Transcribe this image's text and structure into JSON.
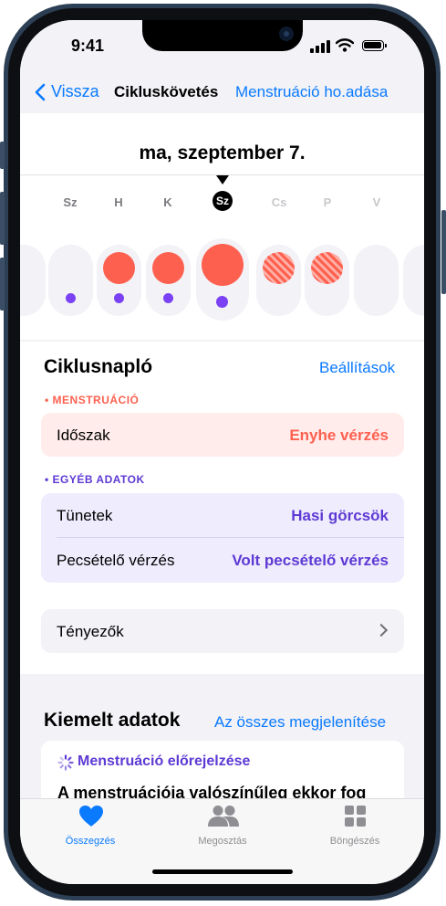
{
  "status": {
    "time": "9:41"
  },
  "nav": {
    "back": "Vissza",
    "title": "Cikluskövetés",
    "action": "Menstruáció ho.adása"
  },
  "calendar": {
    "date_title": "ma, szeptember 7.",
    "days": [
      {
        "label": ""
      },
      {
        "label": "Sz"
      },
      {
        "label": "H"
      },
      {
        "label": "K"
      },
      {
        "label": "Sz"
      },
      {
        "label": "Cs"
      },
      {
        "label": "P"
      },
      {
        "label": "V"
      },
      {
        "label": ""
      }
    ]
  },
  "log": {
    "title": "Ciklusnapló",
    "settings": "Beállítások",
    "menstruation_header": "• MENSTRUÁCIÓ",
    "period_label": "Időszak",
    "period_value": "Enyhe vérzés",
    "other_header": "• EGYÉB ADATOK",
    "symptoms_label": "Tünetek",
    "symptoms_value": "Hasi görcsök",
    "spotting_label": "Pecsételő vérzés",
    "spotting_value": "Volt pecsételő vérzés",
    "factors_label": "Tényezők"
  },
  "highlights": {
    "title": "Kiemelt adatok",
    "show_all": "Az összes megjelenítése",
    "card_title": "Menstruáció előrejelzése",
    "card_text": "A menstruációja valószínűleg ekkor fog"
  },
  "tabs": [
    {
      "label": "Összegzés",
      "icon": "heart-icon"
    },
    {
      "label": "Megosztás",
      "icon": "people-icon"
    },
    {
      "label": "Böngészés",
      "icon": "grid-icon"
    }
  ],
  "colors": {
    "accent": "#0a7aff",
    "menstruation": "#fe6050",
    "other": "#5e3ad4",
    "menstruation_card": "#ffeceb",
    "other_card": "#efecfd"
  }
}
